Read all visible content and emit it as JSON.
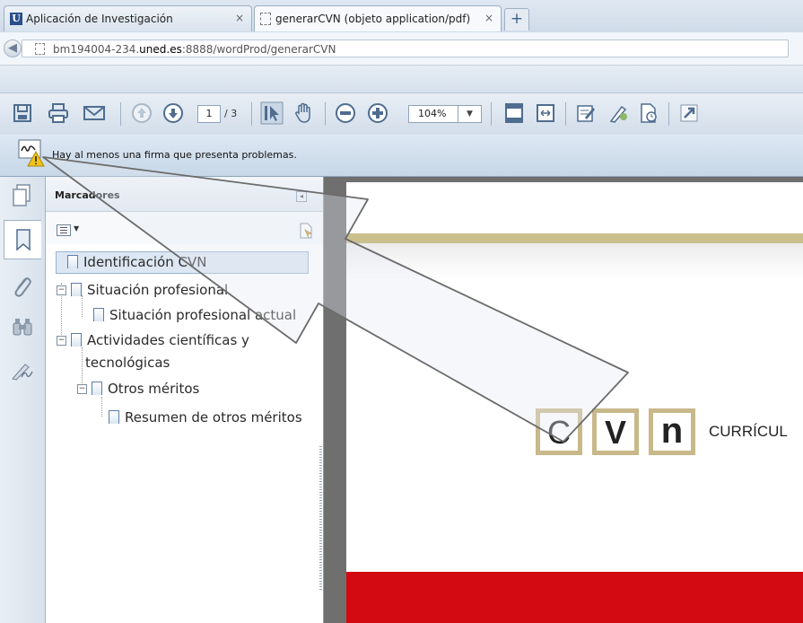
{
  "browser": {
    "tabs": [
      {
        "label": "Aplicación de Investigación",
        "icon": "u-favicon-icon"
      },
      {
        "label": "generarCVN (objeto application/pdf)",
        "icon": "page-icon"
      }
    ],
    "new_tab_symbol": "+",
    "close_symbol": "×",
    "url": {
      "prefix": "bm194004-234.",
      "domain": "uned.es",
      "suffix": ":8888/wordProd/generarCVN"
    }
  },
  "pdf_toolbar": {
    "page_current": "1",
    "page_total": "/ 3",
    "zoom": "104%"
  },
  "signature_bar": {
    "message": "Hay al menos una firma que presenta problemas."
  },
  "bookmarks": {
    "title": "Marcadores",
    "items": [
      {
        "label": "Identificación CVN"
      },
      {
        "label": "Situación profesional"
      },
      {
        "label": "Situación profesional actual"
      },
      {
        "label": "Actividades científicas y"
      },
      {
        "label": "tecnológicas"
      },
      {
        "label": "Otros méritos"
      },
      {
        "label": "Resumen de otros méritos"
      }
    ]
  },
  "document": {
    "logo_letters": [
      "C",
      "V",
      "n"
    ],
    "heading_fragment": "CURRÍCUL",
    "colors": {
      "gold_bar": "#c9c08e",
      "logo_box": "#c8b88a",
      "red_band": "#d30a12"
    }
  }
}
